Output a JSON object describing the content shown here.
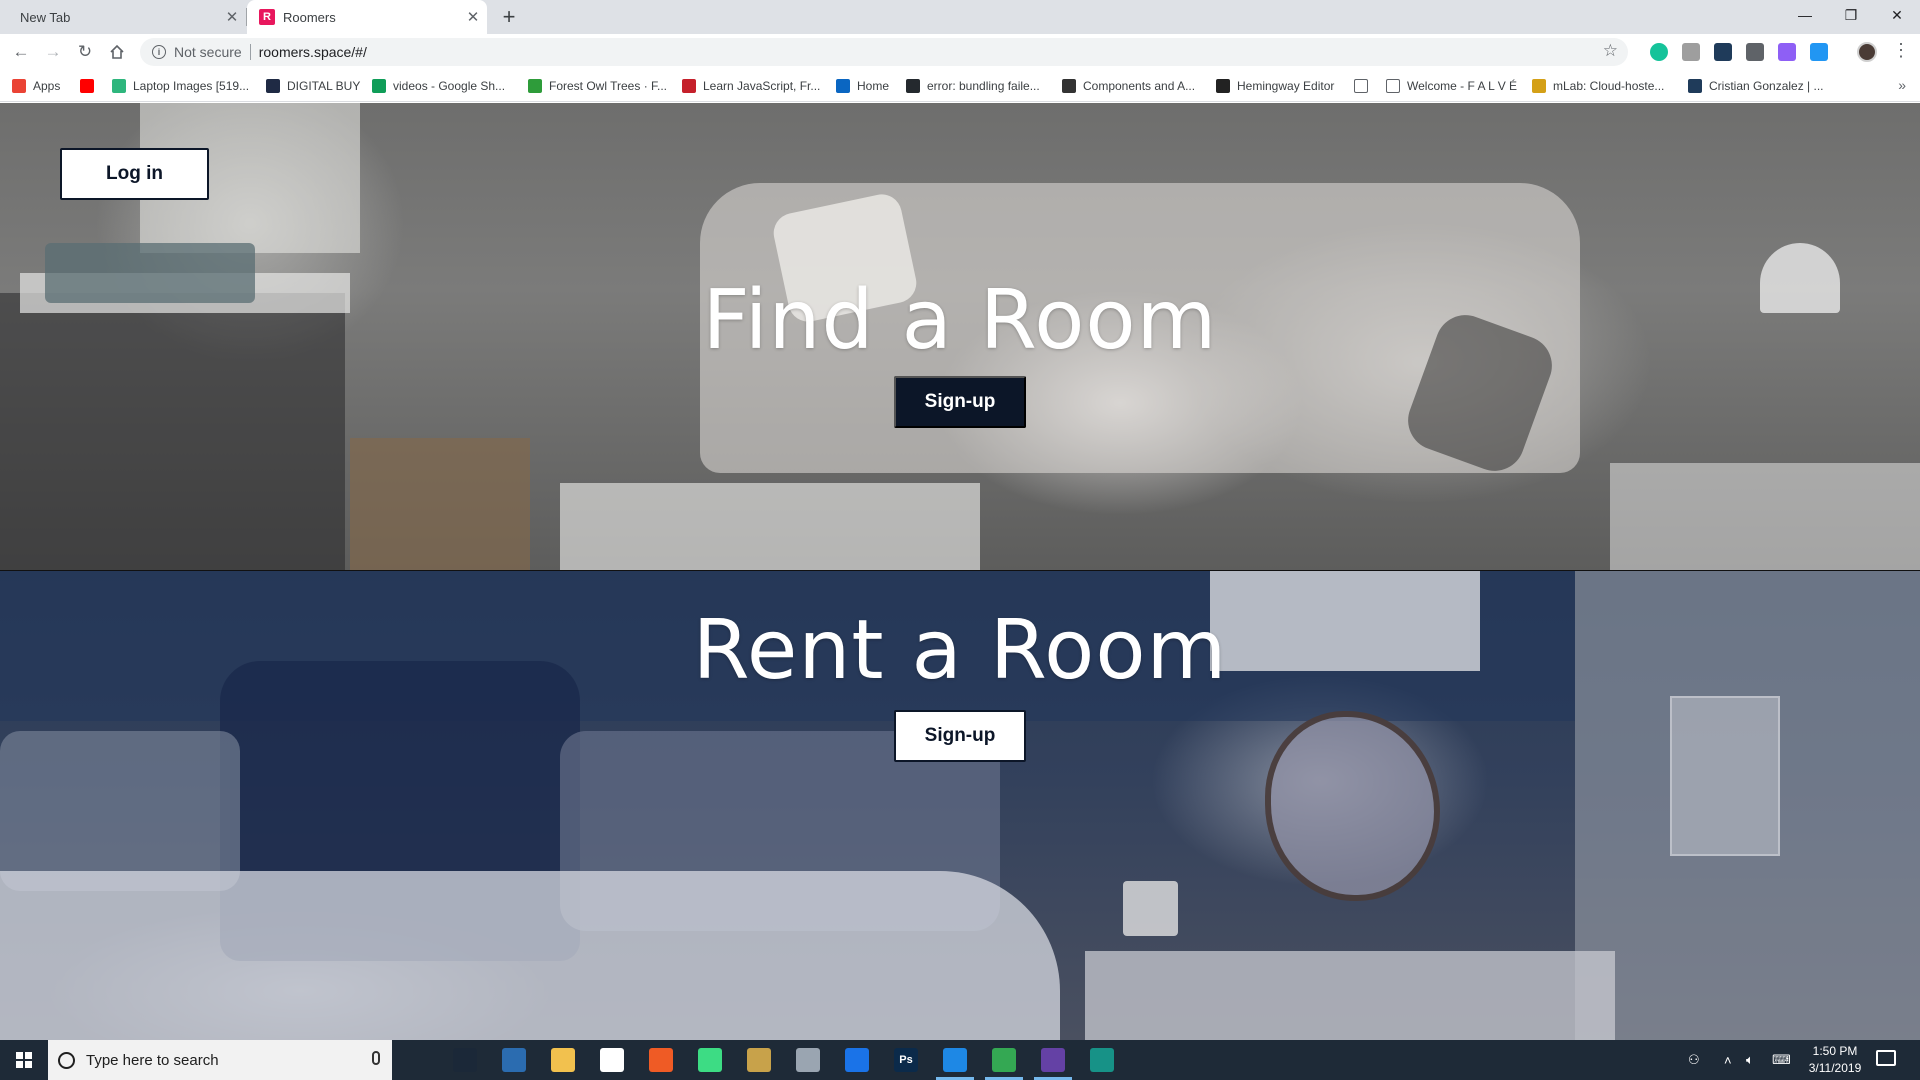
{
  "browser": {
    "tabs": [
      {
        "title": "New Tab",
        "close": "✕"
      },
      {
        "title": "Roomers",
        "favicon": "R",
        "close": "✕"
      }
    ],
    "new_tab": "+",
    "window_controls": {
      "minimize": "—",
      "restore": "❐",
      "close": "✕"
    },
    "address": {
      "security_label": "Not secure",
      "url": "roomers.space/#/"
    },
    "bookmarks": [
      {
        "label": "Apps",
        "icon": "apps-grid-icon",
        "color": "#ea4335"
      },
      {
        "label": "",
        "icon": "youtube-icon",
        "color": "#ff0000"
      },
      {
        "label": "Laptop Images [519...",
        "icon": "page-icon",
        "color": "#2eb67d"
      },
      {
        "label": "DIGITAL BUY",
        "icon": "site-icon",
        "color": "#1f2a44"
      },
      {
        "label": "videos - Google Sh...",
        "icon": "sheets-icon",
        "color": "#0f9d58"
      },
      {
        "label": "Forest Owl Trees · F...",
        "icon": "px-icon",
        "color": "#2e9c3a"
      },
      {
        "label": "Learn JavaScript, Fr...",
        "icon": "scrimba-icon",
        "color": "#c5202b"
      },
      {
        "label": "Home",
        "icon": "linkedin-icon",
        "color": "#0a66c2"
      },
      {
        "label": "error: bundling faile...",
        "icon": "github-icon",
        "color": "#24292e"
      },
      {
        "label": "Components and A...",
        "icon": "site-icon",
        "color": "#333333"
      },
      {
        "label": "Hemingway Editor",
        "icon": "hemingway-icon",
        "color": "#222222"
      },
      {
        "label": "",
        "icon": "page-icon",
        "color": "#ffffff"
      },
      {
        "label": "Welcome - F A L V É",
        "icon": "page-icon",
        "color": "#ffffff"
      },
      {
        "label": "mLab: Cloud-hoste...",
        "icon": "mlab-icon",
        "color": "#d4a017"
      },
      {
        "label": "Cristian Gonzalez | ...",
        "icon": "site-icon",
        "color": "#1f3b5a"
      }
    ],
    "bookmarks_more": "»"
  },
  "page": {
    "login_label": "Log in",
    "find": {
      "title": "Find a Room",
      "button": "Sign-up"
    },
    "rent": {
      "title": "Rent a Room",
      "button": "Sign-up"
    }
  },
  "taskbar": {
    "search_placeholder": "Type here to search",
    "apps": [
      {
        "icon": "task-view-icon",
        "label": "",
        "color": "#1e2a37"
      },
      {
        "icon": "steam-icon",
        "label": "",
        "color": "#1b2838"
      },
      {
        "icon": "store-icon",
        "label": "",
        "color": "#2b6cb0"
      },
      {
        "icon": "file-explorer-icon",
        "label": "",
        "color": "#f2c14e"
      },
      {
        "icon": "mail-icon",
        "label": "",
        "color": "#ffffff"
      },
      {
        "icon": "postman-icon",
        "label": "",
        "color": "#ef5b25"
      },
      {
        "icon": "android-studio-icon",
        "label": "",
        "color": "#3ddc84"
      },
      {
        "icon": "books-icon",
        "label": "",
        "color": "#c8a24a"
      },
      {
        "icon": "app-icon",
        "label": "",
        "color": "#9aa5b1"
      },
      {
        "icon": "firefox-icon",
        "label": "",
        "color": "#1a73e8"
      },
      {
        "icon": "photoshop-icon",
        "label": "Ps",
        "color": "#0b2a4a"
      },
      {
        "icon": "vscode-icon",
        "label": "",
        "color": "#1e88e5"
      },
      {
        "icon": "chrome-icon",
        "label": "",
        "color": "#34a853"
      },
      {
        "icon": "twitch-icon",
        "label": "",
        "color": "#6441a5"
      },
      {
        "icon": "gitkraken-icon",
        "label": "",
        "color": "#179287"
      }
    ],
    "time": "1:50 PM",
    "date": "3/11/2019"
  }
}
